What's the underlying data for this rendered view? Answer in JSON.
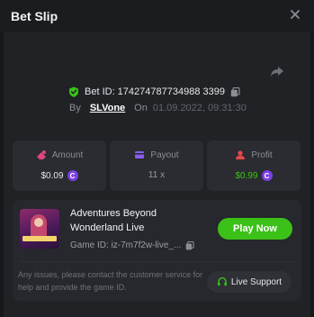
{
  "header": {
    "title": "Bet Slip"
  },
  "bet": {
    "id_label": "Bet ID: 174274787734988 3399",
    "by_label": "By",
    "user": "SLVone",
    "on_label": "On",
    "date": "01.09.2022, 09:31:30"
  },
  "stats": {
    "amount": {
      "label": "Amount",
      "value": "$0.09"
    },
    "payout": {
      "label": "Payout",
      "value": "11 x"
    },
    "profit": {
      "label": "Profit",
      "value": "$0.99"
    }
  },
  "game": {
    "title_line1": "Adventures Beyond",
    "title_line2": "Wonderland Live",
    "id_text": "Game ID: iz-7m7f2w-live_...",
    "play_label": "Play Now"
  },
  "support": {
    "note": "Any issues, please contact the customer service for help and provide the game ID.",
    "button_label": "Live Support"
  },
  "icons": {
    "coin_symbol": "C"
  },
  "colors": {
    "accent_green": "#3bc117",
    "profit_green": "#3bc117",
    "coin_purple": "#7b3fe4",
    "amount_pink": "#e0457b",
    "payout_purple": "#8a5cf0",
    "profit_red": "#e5484d"
  }
}
